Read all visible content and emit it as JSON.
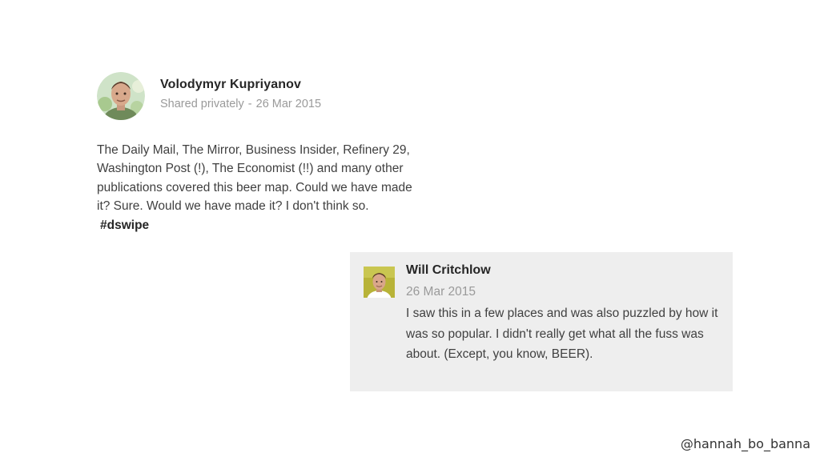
{
  "post": {
    "author": "Volodymyr Kupriyanov",
    "visibility": "Shared privately",
    "separator": "-",
    "date": "26 Mar 2015",
    "body_text": "The Daily Mail, The Mirror, Business Insider, Refinery 29, Washington Post (!), The Economist (!!) and many other publications covered this beer map. Could we have made it? Sure. Would we have made it? I don't think so.",
    "hashtag": "#dswipe"
  },
  "comment": {
    "author": "Will Critchlow",
    "date": "26 Mar 2015",
    "body_text": "I saw this in a few places and was also puzzled by how it was so popular. I didn't really get what all the fuss was about. (Except, you know, BEER)."
  },
  "footer": {
    "handle": "@hannah_bo_banna"
  },
  "colors": {
    "background": "#ffffff",
    "comment_background": "#eeeeee",
    "muted_text": "#9a9a9a",
    "body_text": "#404040"
  }
}
